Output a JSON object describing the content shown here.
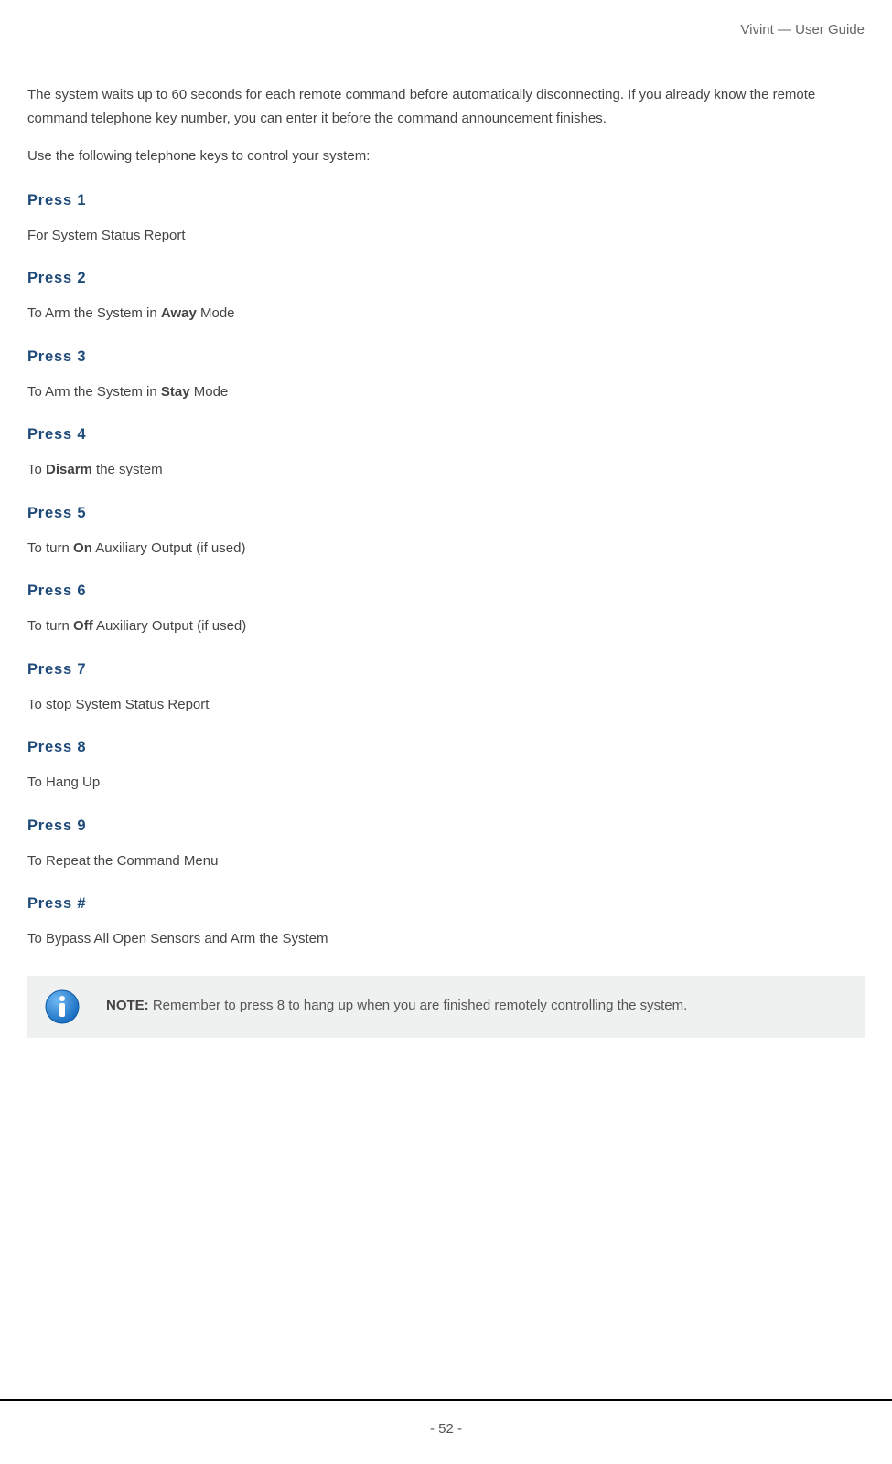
{
  "header": {
    "title": "Vivint — User Guide"
  },
  "intro": {
    "p1": "The system waits up to 60 seconds for each remote command before automatically disconnecting. If you already know the remote command telephone key number, you can enter it before the command announcement finishes.",
    "p2": "Use the following telephone keys to control your system:"
  },
  "presses": [
    {
      "heading": "Press 1",
      "pre": "For System Status Report",
      "bold": "",
      "post": ""
    },
    {
      "heading": "Press 2",
      "pre": "To Arm the System in ",
      "bold": "Away",
      "post": " Mode"
    },
    {
      "heading": "Press 3",
      "pre": "To Arm the System in ",
      "bold": "Stay",
      "post": " Mode"
    },
    {
      "heading": "Press 4",
      "pre": "To ",
      "bold": "Disarm",
      "post": " the system"
    },
    {
      "heading": "Press 5",
      "pre": "To turn ",
      "bold": "On",
      "post": " Auxiliary Output (if used)"
    },
    {
      "heading": "Press 6",
      "pre": "To turn ",
      "bold": "Off",
      "post": " Auxiliary Output (if used)"
    },
    {
      "heading": "Press 7",
      "pre": "To stop System Status Report",
      "bold": "",
      "post": ""
    },
    {
      "heading": "Press 8",
      "pre": "To Hang Up",
      "bold": "",
      "post": ""
    },
    {
      "heading": "Press 9",
      "pre": "To Repeat the Command Menu",
      "bold": "",
      "post": ""
    },
    {
      "heading": "Press #",
      "pre": "To Bypass All Open Sensors and Arm the System",
      "bold": "",
      "post": ""
    }
  ],
  "note": {
    "label": "NOTE:",
    "text": " Remember to press 8 to hang up when you are finished remotely controlling the system."
  },
  "footer": {
    "page_number": "- 52 -"
  }
}
